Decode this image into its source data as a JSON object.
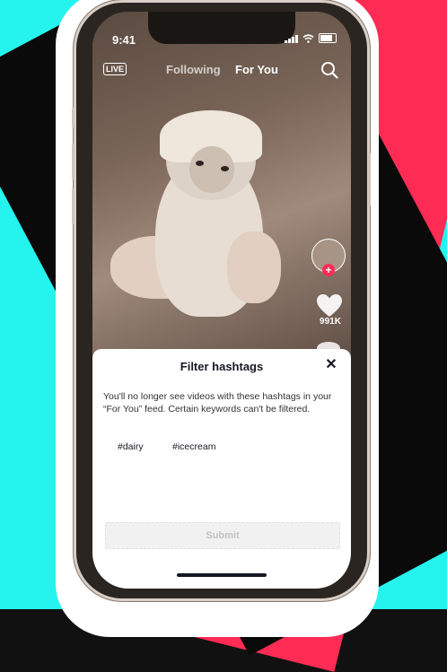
{
  "status_bar": {
    "time": "9:41"
  },
  "top_nav": {
    "live_label": "LIVE",
    "tabs": [
      {
        "label": "Following"
      },
      {
        "label": "For You"
      }
    ],
    "active_tab": "For You"
  },
  "side_actions": {
    "like_count": "991K"
  },
  "sheet": {
    "title": "Filter hashtags",
    "close": "✕",
    "description": "You'll no longer see videos with these hashtags in your “For You” feed. Certain keywords can't be filtered.",
    "hashtags": [
      "#dairy",
      "#icecream"
    ],
    "submit_label": "Submit"
  },
  "colors": {
    "brand_pink": "#FE2C55",
    "brand_cyan": "#25F4EE",
    "text_dark": "#161823"
  },
  "icons": [
    "live-icon",
    "search-icon",
    "heart-icon",
    "close-icon",
    "plus-icon"
  ]
}
